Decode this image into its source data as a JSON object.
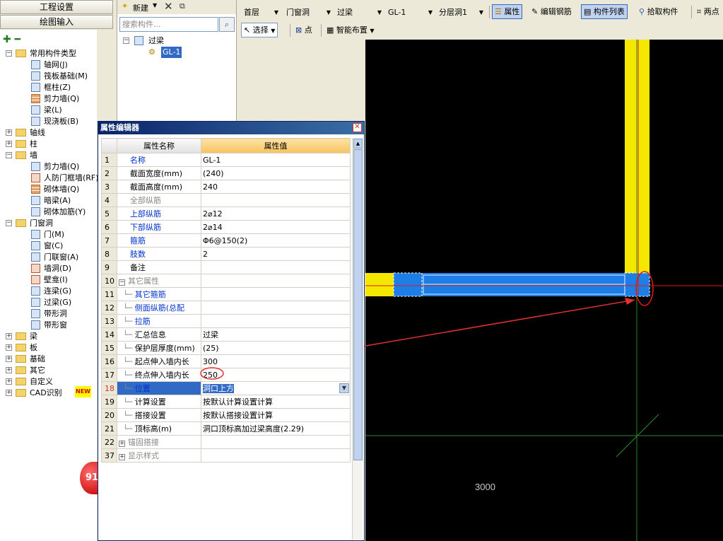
{
  "nav": {
    "project_settings": "工程设置",
    "drawing_input": "绘图输入"
  },
  "tree": {
    "tools": "✚ ━",
    "common_types": "常用构件类型",
    "common_items": [
      "轴网(J)",
      "筏板基础(M)",
      "框柱(Z)",
      "剪力墙(Q)",
      "梁(L)",
      "现浇板(B)"
    ],
    "axis": "轴线",
    "column": "柱",
    "wall": "墙",
    "wall_items": [
      "剪力墙(Q)",
      "人防门框墙(RF)",
      "砌体墙(Q)",
      "暗梁(A)",
      "砌体加筋(Y)"
    ],
    "doors": "门窗洞",
    "door_items": [
      "门(M)",
      "窗(C)",
      "门联窗(A)",
      "墙洞(D)",
      "壁龛(I)",
      "连梁(G)",
      "过梁(G)",
      "带形洞",
      "带形窗"
    ],
    "groups": [
      "梁",
      "板",
      "基础",
      "其它",
      "自定义",
      "CAD识别"
    ],
    "new_badge": "NEW"
  },
  "list_panel": {
    "new_label": "新建",
    "search_placeholder": "搜索构件...",
    "root": "过梁",
    "child": "GL-1"
  },
  "toolbar1": {
    "floor": "首层",
    "category": "门窗洞",
    "type": "过梁",
    "component": "GL-1",
    "layer": "分层洞1",
    "property": "属性",
    "edit_rebar": "编辑钢筋",
    "component_list": "构件列表",
    "pick": "拾取构件",
    "two_points": "两点"
  },
  "toolbar2": {
    "select": "选择",
    "point": "点",
    "smart_layout": "智能布置"
  },
  "prop_editor": {
    "title": "属性编辑器",
    "col_name": "属性名称",
    "col_value": "属性值",
    "rows": [
      {
        "n": "1",
        "name": "名称",
        "value": "GL-1"
      },
      {
        "n": "2",
        "name": "截面宽度(mm)",
        "value": "(240)"
      },
      {
        "n": "3",
        "name": "截面高度(mm)",
        "value": "240"
      },
      {
        "n": "4",
        "name": "全部纵筋",
        "value": ""
      },
      {
        "n": "5",
        "name": "上部纵筋",
        "value": "2⌀12"
      },
      {
        "n": "6",
        "name": "下部纵筋",
        "value": "2⌀14"
      },
      {
        "n": "7",
        "name": "箍筋",
        "value": "Φ6@150(2)"
      },
      {
        "n": "8",
        "name": "肢数",
        "value": "2"
      },
      {
        "n": "9",
        "name": "备注",
        "value": ""
      },
      {
        "n": "10",
        "name": "其它属性",
        "value": ""
      },
      {
        "n": "11",
        "name": "其它箍筋",
        "value": ""
      },
      {
        "n": "12",
        "name": "侧面纵筋(总配",
        "value": ""
      },
      {
        "n": "13",
        "name": "拉筋",
        "value": ""
      },
      {
        "n": "14",
        "name": "汇总信息",
        "value": "过梁"
      },
      {
        "n": "15",
        "name": "保护层厚度(mm)",
        "value": "(25)"
      },
      {
        "n": "16",
        "name": "起点伸入墙内长",
        "value": "300"
      },
      {
        "n": "17",
        "name": "终点伸入墙内长",
        "value": "250"
      },
      {
        "n": "18",
        "name": "位置",
        "value": "洞口上方"
      },
      {
        "n": "19",
        "name": "计算设置",
        "value": "按默认计算设置计算"
      },
      {
        "n": "20",
        "name": "搭接设置",
        "value": "按默认搭接设置计算"
      },
      {
        "n": "21",
        "name": "顶标高(m)",
        "value": "洞口顶标高加过梁高度(2.29)"
      },
      {
        "n": "22",
        "name": "锚固搭接",
        "value": ""
      },
      {
        "n": "37",
        "name": "显示样式",
        "value": ""
      }
    ]
  },
  "canvas": {
    "dimension_label": "3000"
  },
  "badge": {
    "count": "91"
  },
  "colors": {
    "canvas_bg": "#000000",
    "wall_yellow": "#f5e800",
    "beam_blue": "#1e7ee8",
    "axis_red": "#e01818",
    "axis_green": "#2a8a2a"
  }
}
